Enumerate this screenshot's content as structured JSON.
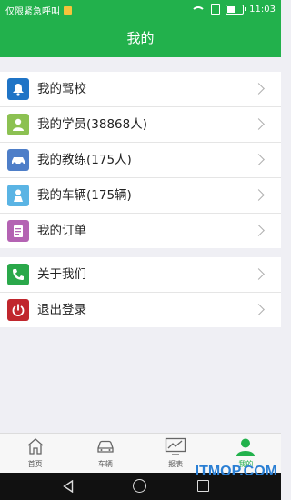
{
  "status_bar": {
    "carrier": "仅限紧急呼叫",
    "time": "11:03"
  },
  "header": {
    "title": "我的"
  },
  "menu_group_1": [
    {
      "label": "我的驾校",
      "icon": "bell-icon",
      "color": "#1f74c6"
    },
    {
      "label": "我的学员(38868人)",
      "icon": "student-icon",
      "color": "#8cc152"
    },
    {
      "label": "我的教练(175人)",
      "icon": "car-icon",
      "color": "#4e7ec8"
    },
    {
      "label": "我的车辆(175辆)",
      "icon": "vehicle-person-icon",
      "color": "#5ab4e4"
    },
    {
      "label": "我的订单",
      "icon": "order-icon",
      "color": "#b463b3"
    }
  ],
  "menu_group_2": [
    {
      "label": "关于我们",
      "icon": "phone-icon",
      "color": "#2aa84a"
    },
    {
      "label": "退出登录",
      "icon": "power-icon",
      "color": "#c0262d"
    }
  ],
  "tabbar": {
    "tabs": [
      {
        "label": "首页",
        "icon": "home-icon"
      },
      {
        "label": "车辆",
        "icon": "car-outline-icon"
      },
      {
        "label": "报表",
        "icon": "chart-icon"
      },
      {
        "label": "我的",
        "icon": "person-icon"
      }
    ],
    "active": "我的"
  },
  "watermark": "ITMOP.COM",
  "colors": {
    "primary": "#22b14c",
    "background": "#efeff4"
  }
}
